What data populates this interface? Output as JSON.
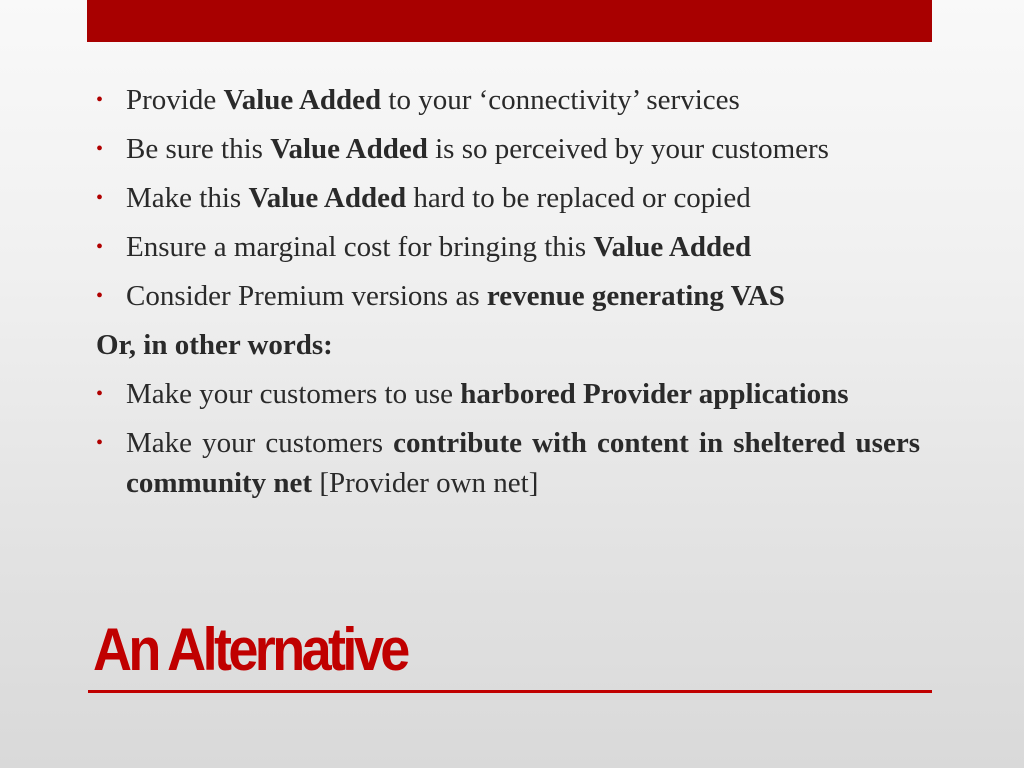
{
  "slide": {
    "title": "An Alternative",
    "accent_color": "#b00000",
    "bullets_part1": [
      {
        "segments": [
          {
            "text": "Provide ",
            "bold": false
          },
          {
            "text": "Value Added",
            "bold": true
          },
          {
            "text": " to your ‘connectivity’ services",
            "bold": false
          }
        ]
      },
      {
        "segments": [
          {
            "text": "Be sure this ",
            "bold": false
          },
          {
            "text": "Value Added",
            "bold": true
          },
          {
            "text": " is so perceived by your customers",
            "bold": false
          }
        ]
      },
      {
        "segments": [
          {
            "text": "Make this ",
            "bold": false
          },
          {
            "text": "Value Added",
            "bold": true
          },
          {
            "text": " hard to be replaced or copied",
            "bold": false
          }
        ]
      },
      {
        "segments": [
          {
            "text": "Ensure a marginal cost for bringing this ",
            "bold": false
          },
          {
            "text": "Value Added",
            "bold": true
          }
        ]
      },
      {
        "segments": [
          {
            "text": "Consider Premium versions as ",
            "bold": false
          },
          {
            "text": "revenue generating VAS",
            "bold": true
          }
        ]
      }
    ],
    "subheading": "Or, in other words:",
    "bullets_part2": [
      {
        "segments": [
          {
            "text": "Make your customers to use ",
            "bold": false
          },
          {
            "text": "harbored Provider applications",
            "bold": true
          }
        ]
      },
      {
        "segments": [
          {
            "text": "Make your customers ",
            "bold": false
          },
          {
            "text": "contribute with content in sheltered users community net",
            "bold": true
          },
          {
            "text": " [Provider own net]",
            "bold": false
          }
        ]
      }
    ]
  }
}
